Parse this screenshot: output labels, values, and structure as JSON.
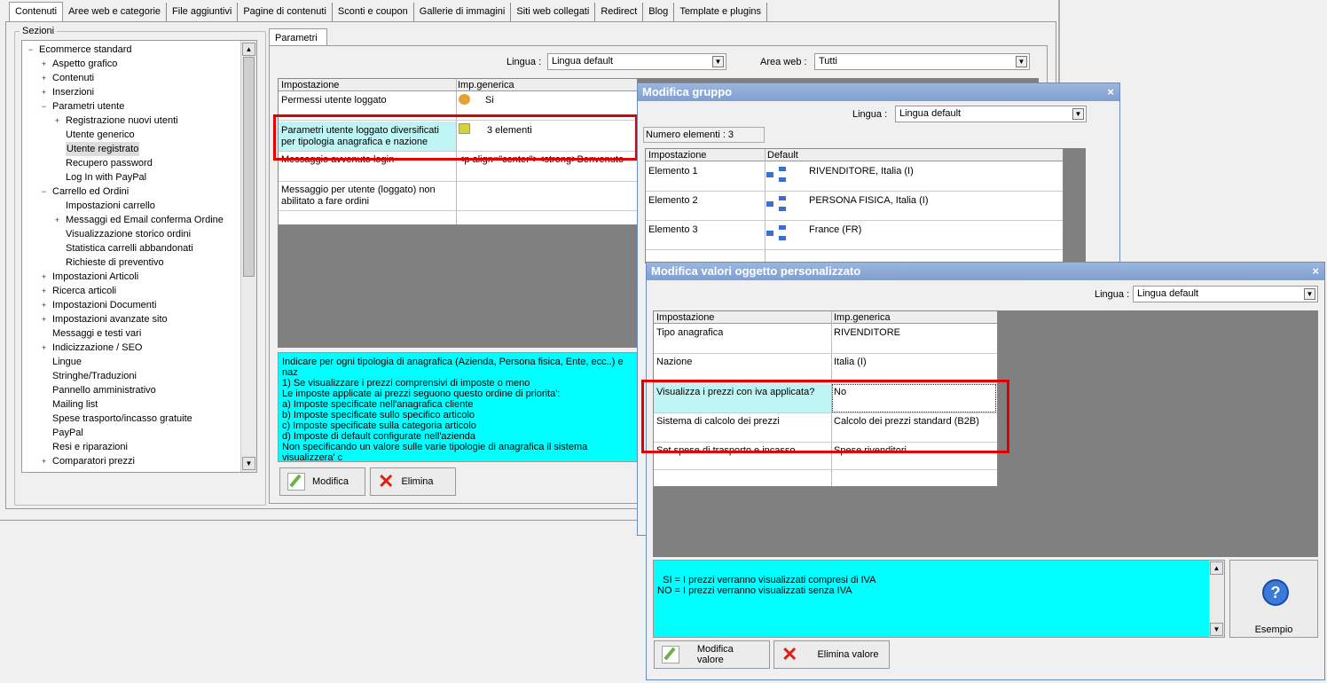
{
  "tabs": [
    "Contenuti",
    "Aree web e categorie",
    "File aggiuntivi",
    "Pagine di contenuti",
    "Sconti e coupon",
    "Gallerie di immagini",
    "Siti web collegati",
    "Redirect",
    "Blog",
    "Template e plugins"
  ],
  "sections": {
    "label": "Sezioni",
    "items": [
      "Ecommerce standard",
      "Aspetto grafico",
      "Contenuti",
      "Inserzioni",
      "Parametri utente",
      "Registrazione nuovi utenti",
      "Utente generico",
      "Utente registrato",
      "Recupero password",
      "Log In with PayPal",
      "Carrello ed Ordini",
      "Impostazioni carrello",
      "Messaggi ed Email conferma Ordine",
      "Visualizzazione storico ordini",
      "Statistica carrelli abbandonati",
      "Richieste di preventivo",
      "Impostazioni Articoli",
      "Ricerca articoli",
      "Impostazioni Documenti",
      "Impostazioni avanzate sito",
      "Messaggi e testi vari",
      "Indicizzazione / SEO",
      "Lingue",
      "Stringhe/Traduzioni",
      "Pannello amministrativo",
      "Mailing list",
      "Spese trasporto/incasso gratuite",
      "PayPal",
      "Resi e riparazioni",
      "Comparatori prezzi"
    ]
  },
  "params": {
    "tab": "Parametri",
    "lingua_label": "Lingua :",
    "lingua_value": "Lingua default",
    "area_label": "Area web :",
    "area_value": "Tutti",
    "col1": "Impostazione",
    "col2": "Imp.generica",
    "rows": [
      {
        "name": "Permessi utente loggato",
        "value": "Si"
      },
      {
        "name": "Parametri utente loggato diversificati per tipologia anagrafica e nazione",
        "value": "3 elementi"
      },
      {
        "name": "Messaggio avvenuto login",
        "value": "<p align=\"center\"><strong>Benvenuto"
      },
      {
        "name": "Messaggio per utente (loggato) non abilitato a fare ordini",
        "value": ""
      }
    ],
    "info": "Indicare per ogni tipologia di anagrafica (Azienda, Persona fisica, Ente, ecc..) e naz\n1) Se visualizzare i prezzi comprensivi di imposte o meno\nLe imposte applicate ai prezzi seguono questo ordine di priorita':\na) Imposte specificate nell'anagrafica cliente\nb) Imposte specificate sullo specifico articolo\nc) Imposte specificate sulla categoria articolo\nd) Imposte di default configurate nell'azienda\nNon specificando un valore sulle varie tipologie di anagrafica il sistema visualizzera' c\nsopra esposti.",
    "btn_modifica": "Modifica",
    "btn_elimina": "Elimina"
  },
  "group_win": {
    "title": "Modifica gruppo",
    "close": "×",
    "lingua_label": "Lingua :",
    "lingua_value": "Lingua default",
    "count": "Numero elementi : 3",
    "col1": "Impostazione",
    "col2": "Default",
    "rows": [
      {
        "name": "Elemento 1",
        "value": "RIVENDITORE, Italia (I)"
      },
      {
        "name": "Elemento 2",
        "value": "PERSONA FISICA, Italia (I)"
      },
      {
        "name": "Elemento 3",
        "value": "France (FR)"
      }
    ]
  },
  "obj_win": {
    "title": "Modifica valori oggetto personalizzato",
    "close": "×",
    "lingua_label": "Lingua :",
    "lingua_value": "Lingua default",
    "col1": "Impostazione",
    "col2": "Imp.generica",
    "rows": [
      {
        "name": "Tipo anagrafica",
        "value": "RIVENDITORE"
      },
      {
        "name": "Nazione",
        "value": "Italia (I)"
      },
      {
        "name": "Visualizza i prezzi con iva applicata?",
        "value": "No"
      },
      {
        "name": "Sistema di calcolo dei prezzi",
        "value": "Calcolo dei prezzi standard (B2B)"
      },
      {
        "name": "Set spese di trasporto e incasso",
        "value": "Spese rivenditori"
      }
    ],
    "info": "SI = I prezzi verranno visualizzati compresi di IVA\nNO = I prezzi verranno visualizzati senza IVA",
    "btn_esempio": "Esempio",
    "btn_modifica": "Modifica valore",
    "btn_elimina": "Elimina valore"
  }
}
